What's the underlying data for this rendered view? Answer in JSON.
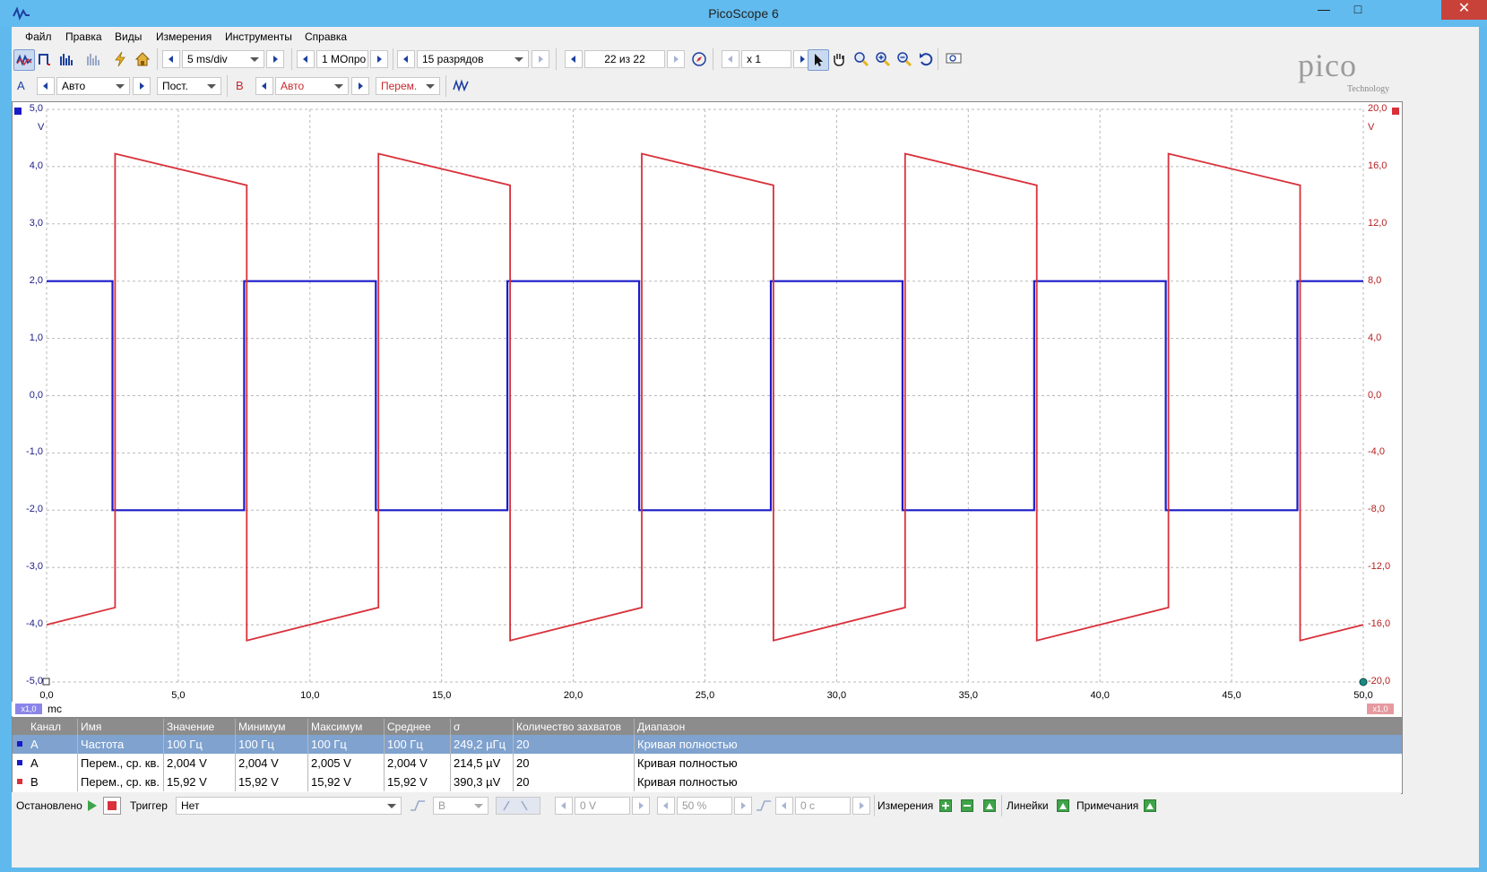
{
  "window": {
    "title": "PicoScope 6",
    "minimize_glyph": "—",
    "maximize_glyph": "□",
    "close_glyph": "✕"
  },
  "menu": [
    "Файл",
    "Правка",
    "Виды",
    "Измерения",
    "Инструменты",
    "Справка"
  ],
  "toolbar1": {
    "timebase": "5 ms/div",
    "samples": "1 MОпро",
    "resolution": "15 разрядов",
    "capture": "22 из 22",
    "zoom": "x 1"
  },
  "toolbar2": {
    "ch_a_label": "A",
    "ch_a_range": "Авто",
    "ch_a_coupling": "Пост.",
    "ch_b_label": "B",
    "ch_b_range": "Авто",
    "ch_b_coupling": "Перем."
  },
  "logo": {
    "main": "pico",
    "sub": "Technology"
  },
  "scope": {
    "left_unit": "V",
    "right_unit": "V",
    "x_unit": "mc",
    "x_scale_left": "x1,0",
    "x_scale_right": "x1,0",
    "left_ticks": [
      "5,0",
      "4,0",
      "3,0",
      "2,0",
      "1,0",
      "0,0",
      "-1,0",
      "-2,0",
      "-3,0",
      "-4,0",
      "-5,0"
    ],
    "right_ticks": [
      "20,0",
      "16,0",
      "12,0",
      "8,0",
      "4,0",
      "0,0",
      "-4,0",
      "-8,0",
      "-12,0",
      "-16,0",
      "-20,0"
    ],
    "x_ticks": [
      "0,0",
      "5,0",
      "10,0",
      "15,0",
      "20,0",
      "25,0",
      "30,0",
      "35,0",
      "40,0",
      "45,0",
      "50,0"
    ],
    "colors": {
      "channel_a": "#1a1ac8",
      "channel_b": "#d9303a",
      "grid": "#b9b9b9"
    }
  },
  "chart_data": {
    "type": "line",
    "xlabel": "mc",
    "xlim": [
      0,
      50
    ],
    "ylim_left": [
      -5,
      5
    ],
    "ylim_right": [
      -20,
      20
    ],
    "grid": true,
    "series": [
      {
        "name": "A",
        "axis": "left",
        "x": [
          0,
          2.5,
          2.5,
          7.5,
          7.5,
          12.5,
          12.5,
          17.5,
          17.5,
          22.5,
          22.5,
          27.5,
          27.5,
          32.5,
          32.5,
          37.5,
          37.5,
          42.5,
          42.5,
          47.5,
          47.5,
          50
        ],
        "y": [
          2,
          2,
          -2,
          -2,
          2,
          2,
          -2,
          -2,
          2,
          2,
          -2,
          -2,
          2,
          2,
          -2,
          -2,
          2,
          2,
          -2,
          -2,
          2,
          2
        ]
      },
      {
        "name": "B",
        "axis": "right",
        "x": [
          0,
          2.6,
          2.6,
          7.6,
          7.6,
          12.6,
          12.6,
          17.6,
          17.6,
          22.6,
          22.6,
          27.6,
          27.6,
          32.6,
          32.6,
          37.6,
          37.6,
          42.6,
          42.6,
          47.6,
          47.6,
          50
        ],
        "y": [
          -16.0,
          -14.8,
          16.9,
          14.7,
          -17.1,
          -14.8,
          16.9,
          14.7,
          -17.1,
          -14.8,
          16.9,
          14.7,
          -17.1,
          -14.8,
          16.9,
          14.7,
          -17.1,
          -14.8,
          16.9,
          14.7,
          -17.1,
          -16.0
        ]
      }
    ]
  },
  "measurements": {
    "headers": [
      "Канал",
      "Имя",
      "Значение",
      "Минимум",
      "Максимум",
      "Среднее",
      "σ",
      "Количество захватов",
      "Диапазон"
    ],
    "rows": [
      [
        "A",
        "Частота",
        "100 Гц",
        "100 Гц",
        "100 Гц",
        "100 Гц",
        "249,2 µГц",
        "20",
        "Кривая полностью"
      ],
      [
        "A",
        "Перем., ср. кв.",
        "2,004 V",
        "2,004 V",
        "2,005 V",
        "2,004 V",
        "214,5 µV",
        "20",
        "Кривая полностью"
      ],
      [
        "B",
        "Перем., ср. кв.",
        "15,92 V",
        "15,92 V",
        "15,92 V",
        "15,92 V",
        "390,3 µV",
        "20",
        "Кривая полностью"
      ]
    ]
  },
  "status": {
    "state": "Остановлено",
    "trigger_label": "Триггер",
    "trigger_mode": "Нет",
    "trigger_channel": "B",
    "trigger_level": "0 V",
    "pretrigger": "50 %",
    "delay": "0 с",
    "measure_label": "Измерения",
    "rulers_label": "Линейки",
    "notes_label": "Примечания"
  }
}
